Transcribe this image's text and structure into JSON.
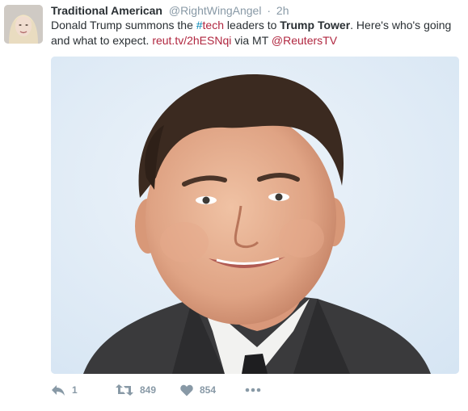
{
  "tweet": {
    "fullname": "Traditional American",
    "username": "@RightWingAngel",
    "separator": "·",
    "time": "2h",
    "text": {
      "part1": "Donald Trump summons the ",
      "hashtag_symbol": "#",
      "hashtag_word": "tech",
      "part2": " leaders to ",
      "bold": "Trump Tower",
      "part3": ". Here's who's going and what to expect. ",
      "link": "reut.tv/2hESNqi",
      "part4": " via MT  ",
      "mention": "@ReutersTV"
    },
    "actions": {
      "reply_count": "1",
      "retweet_count": "849",
      "like_count": "854"
    }
  },
  "colors": {
    "link_blue": "#0084b4",
    "link_red": "#b0263f",
    "secondary": "#8899a6",
    "text": "#292f33"
  },
  "icons": [
    "reply-icon",
    "retweet-icon",
    "heart-icon",
    "more-icon"
  ]
}
